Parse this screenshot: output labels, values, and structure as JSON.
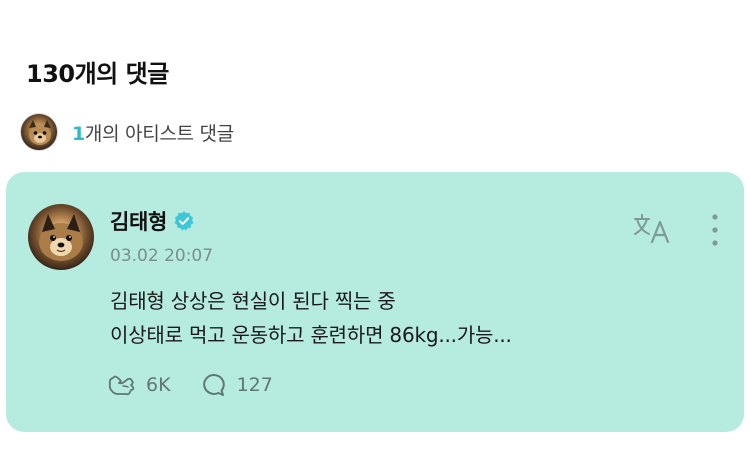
{
  "comments_header": {
    "count_title": "130개의 댓글"
  },
  "artist_comments": {
    "count": "1",
    "label": "개의 아티스트 댓글"
  },
  "comment": {
    "author": "김태형",
    "timestamp": "03.02 20:07",
    "lines": [
      "김태형 상상은 현실이 된다 찍는 중",
      "이상태로 먹고 운동하고 훈련하면 86kg...가능..."
    ],
    "likes": "6K",
    "replies": "127"
  },
  "colors": {
    "card_bg": "#b6ebe0",
    "accent": "#2fb9c9",
    "verified": "#3cc8d8"
  },
  "icons": [
    "verified-badge-icon",
    "translate-icon",
    "more-vertical-icon",
    "like-icon",
    "reply-icon"
  ]
}
